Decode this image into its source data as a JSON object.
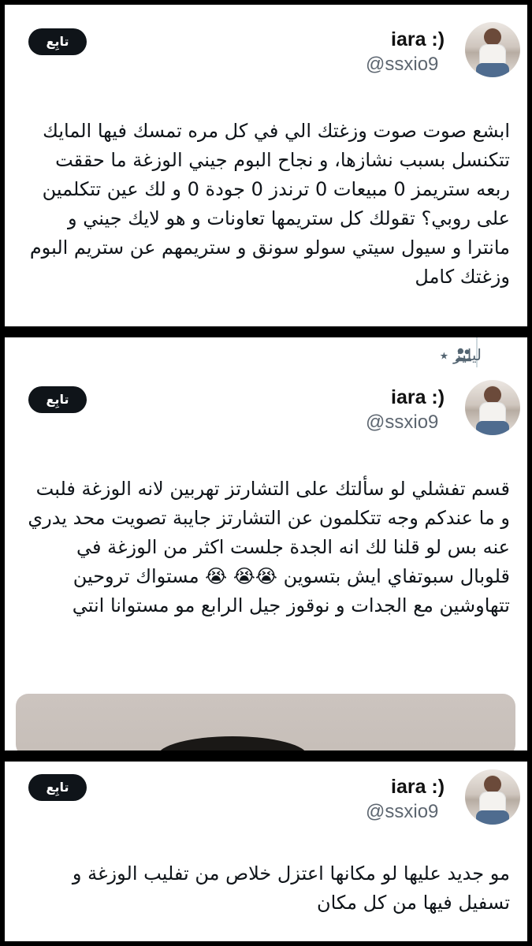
{
  "tweets": [
    {
      "author": {
        "name": "iara :)",
        "handle": "@ssxio9"
      },
      "follow_label": "تابِع",
      "text": "ابشع صوت صوت وزغتك الي في كل مره تمسك فيها المايك تتكنسل بسبب نشازها، و نجاح البوم جيني الوزغة ما حققت ربعه ستريمز 0 مبيعات 0 ترندز 0 جودة 0 و لك عين تتكلمين على روبي؟ تقولك كل ستريمها تعاونات و هو لايك جيني و مانترا و سيول سيتي سولو سونق و ستريمهم عن ستريم البوم وزغتك كامل"
    },
    {
      "group_label": "ليليز ⭑",
      "author": {
        "name": "iara :)",
        "handle": "@ssxio9"
      },
      "follow_label": "تابِع",
      "text": "قسم تفشلي لو سألتك على التشارتز تهربين لانه الوزغة فلبت و ما عندكم وجه تتكلمون عن التشارتز جايبة تصويت محد يدري عنه بس لو قلنا لك انه الجدة جلست اكثر من الوزغة في قلوبال سبوتفاي ايش بتسوين 😭😭 😭 مستواك تروحين تتهاوشين مع الجدات و نوقوز جيل الرابع مو مستوانا انتي"
    },
    {
      "author": {
        "name": "iara :)",
        "handle": "@ssxio9"
      },
      "follow_label": "تابِع",
      "text": "مو جديد عليها لو مكانها اعتزل خلاص من تفليب الوزغة و تسفيل فيها من كل مكان"
    }
  ],
  "icons": [
    "people-icon"
  ],
  "colors": {
    "follow_bg": "#0f1419",
    "handle": "#5d6670",
    "separator": "#000000"
  }
}
